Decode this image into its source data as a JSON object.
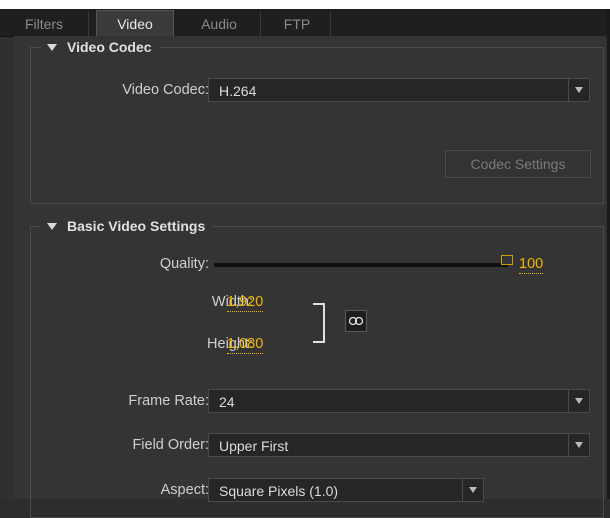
{
  "tabs": [
    {
      "label": "Filters"
    },
    {
      "label": "Video"
    },
    {
      "label": "Audio"
    },
    {
      "label": "FTP"
    }
  ],
  "video_codec_group": {
    "title": "Video Codec",
    "codec_label": "Video Codec:",
    "codec_value": "H.264",
    "codec_settings_button": "Codec Settings"
  },
  "basic_settings_group": {
    "title": "Basic Video Settings",
    "quality_label": "Quality:",
    "quality_value": "100",
    "quality_level": 1.0,
    "width_label": "Width:",
    "width_value": "1,920",
    "height_label": "Height:",
    "height_value": "1,080",
    "frame_rate_label": "Frame Rate:",
    "frame_rate_value": "24",
    "field_order_label": "Field Order:",
    "field_order_value": "Upper First",
    "aspect_label": "Aspect:",
    "aspect_value": "Square Pixels (1.0)"
  },
  "colors": {
    "accent": "#f2b600",
    "background": "#343434"
  },
  "icons": {
    "group_toggle": "triangle-down-icon",
    "dropdown": "chevron-down-icon",
    "link": "chain-link-icon"
  }
}
